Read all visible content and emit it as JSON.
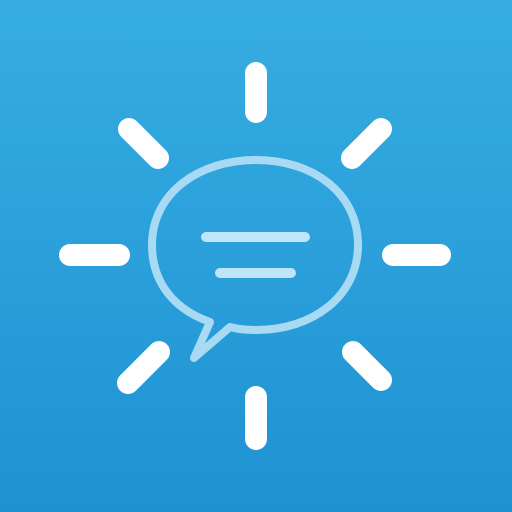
{
  "icon": {
    "semantic": "sun-with-chat-bubble-app-icon",
    "colors": {
      "background_top": "#36ade2",
      "background_bottom": "#1f92d2",
      "rays": "#ffffff",
      "bubble_outline": "#a9daf4",
      "bubble_lines": "#bfe5f8"
    }
  }
}
